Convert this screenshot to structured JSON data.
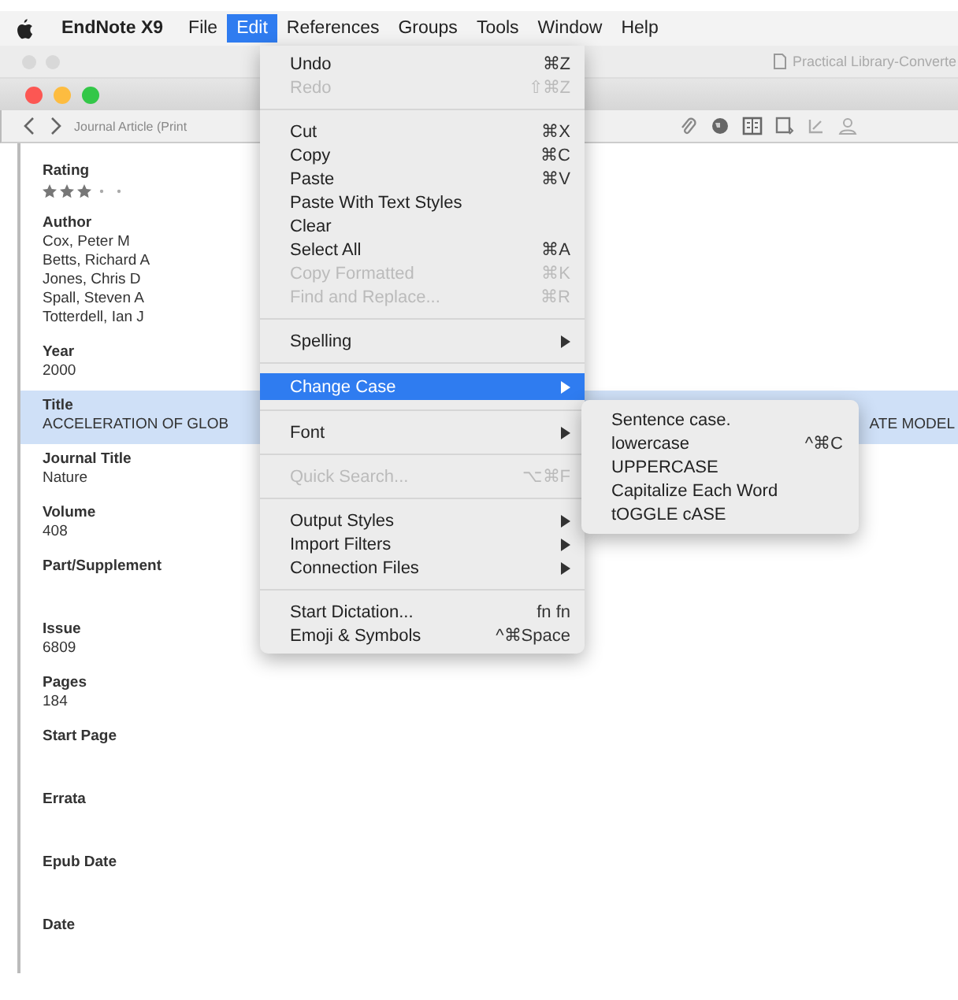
{
  "menubar": {
    "app": "EndNote X9",
    "items": [
      {
        "label": "File",
        "selected": false
      },
      {
        "label": "Edit",
        "selected": true
      },
      {
        "label": "References",
        "selected": false
      },
      {
        "label": "Groups",
        "selected": false
      },
      {
        "label": "Tools",
        "selected": false
      },
      {
        "label": "Window",
        "selected": false
      },
      {
        "label": "Help",
        "selected": false
      }
    ]
  },
  "window": {
    "title": "Practical Library-Converte"
  },
  "toolbar": {
    "reference_type": "Journal Article (Print"
  },
  "fields": [
    {
      "label": "Rating",
      "kind": "stars",
      "stars": 3
    },
    {
      "label": "Author",
      "kind": "text",
      "lines": [
        "Cox, Peter M",
        "Betts, Richard A",
        "Jones, Chris D",
        "Spall, Steven A",
        "Totterdell, Ian J"
      ]
    },
    {
      "label": "Year",
      "kind": "text",
      "lines": [
        "2000"
      ]
    },
    {
      "label": "Title",
      "kind": "title",
      "selected": true,
      "start": "ACCELERATION OF GLOB",
      "end": "ATE MODEL"
    },
    {
      "label": "Journal Title",
      "kind": "text",
      "lines": [
        "Nature"
      ]
    },
    {
      "label": "Volume",
      "kind": "text",
      "lines": [
        "408"
      ]
    },
    {
      "label": "Part/Supplement",
      "kind": "text"
    },
    {
      "label": "Issue",
      "kind": "text",
      "lines": [
        "6809"
      ]
    },
    {
      "label": "Pages",
      "kind": "text",
      "lines": [
        "184"
      ]
    },
    {
      "label": "Start Page",
      "kind": "text"
    },
    {
      "label": "Errata",
      "kind": "text"
    },
    {
      "label": "Epub Date",
      "kind": "text"
    },
    {
      "label": "Date",
      "kind": "text"
    }
  ],
  "edit_menu": [
    {
      "kind": "item",
      "label": "Undo",
      "shortcut": "⌘Z",
      "disabled": false
    },
    {
      "kind": "item",
      "label": "Redo",
      "shortcut": "⇧⌘Z",
      "disabled": true
    },
    {
      "kind": "separator"
    },
    {
      "kind": "item",
      "label": "Cut",
      "shortcut": "⌘X",
      "disabled": false
    },
    {
      "kind": "item",
      "label": "Copy",
      "shortcut": "⌘C",
      "disabled": false
    },
    {
      "kind": "item",
      "label": "Paste",
      "shortcut": "⌘V",
      "disabled": false
    },
    {
      "kind": "item",
      "label": "Paste With Text Styles",
      "disabled": false
    },
    {
      "kind": "item",
      "label": "Clear",
      "disabled": false
    },
    {
      "kind": "item",
      "label": "Select All",
      "shortcut": "⌘A",
      "disabled": false
    },
    {
      "kind": "item",
      "label": "Copy Formatted",
      "shortcut": "⌘K",
      "disabled": true
    },
    {
      "kind": "item",
      "label": "Find and Replace...",
      "shortcut": "⌘R",
      "disabled": true
    },
    {
      "kind": "separator"
    },
    {
      "kind": "submenu",
      "label": "Spelling",
      "selected": false
    },
    {
      "kind": "separator"
    },
    {
      "kind": "submenu",
      "label": "Change Case",
      "selected": true
    },
    {
      "kind": "separator"
    },
    {
      "kind": "submenu",
      "label": "Font",
      "selected": false
    },
    {
      "kind": "separator"
    },
    {
      "kind": "item",
      "label": "Quick Search...",
      "shortcut": "⌥⌘F",
      "disabled": true
    },
    {
      "kind": "separator"
    },
    {
      "kind": "submenu",
      "label": "Output Styles",
      "selected": false
    },
    {
      "kind": "submenu",
      "label": "Import Filters",
      "selected": false
    },
    {
      "kind": "submenu",
      "label": "Connection Files",
      "selected": false
    },
    {
      "kind": "separator"
    },
    {
      "kind": "item",
      "label": "Start Dictation...",
      "shortcut": "fn fn",
      "disabled": false
    },
    {
      "kind": "item",
      "label": "Emoji & Symbols",
      "shortcut": "^⌘Space",
      "disabled": false
    }
  ],
  "change_case_menu": [
    {
      "label": "Sentence case."
    },
    {
      "label": "lowercase",
      "shortcut": "^⌘C"
    },
    {
      "label": "UPPERCASE"
    },
    {
      "label": "Capitalize Each Word"
    },
    {
      "label": "tOGGLE cASE"
    }
  ]
}
